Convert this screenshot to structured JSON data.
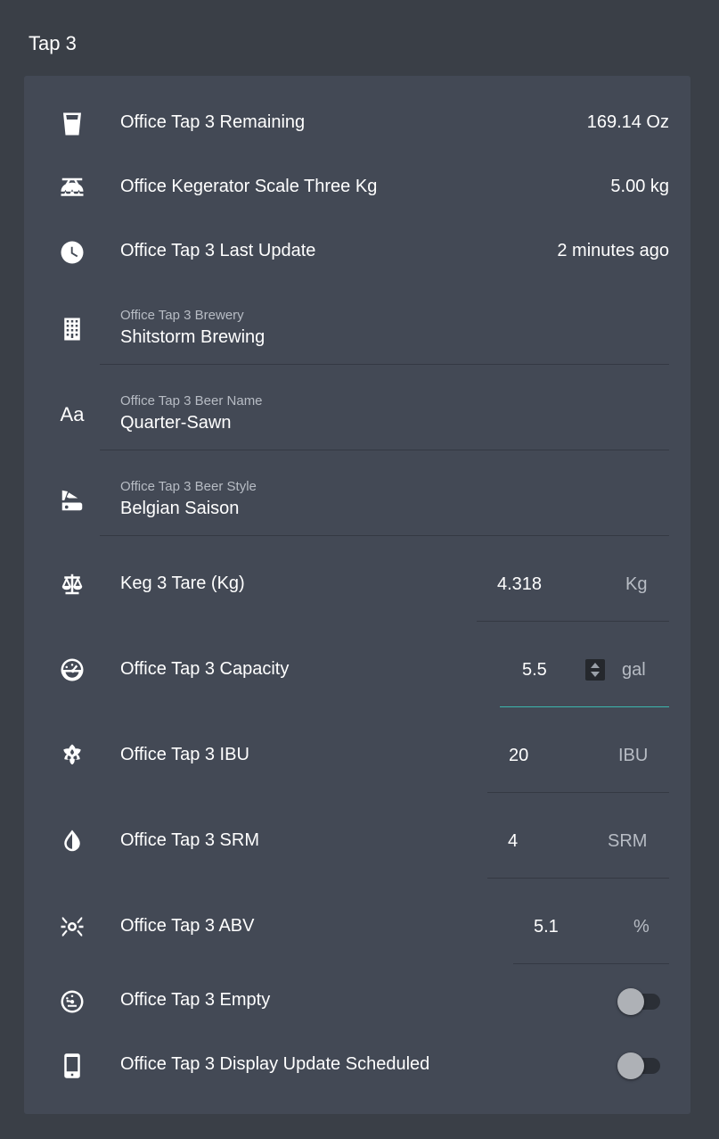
{
  "card_title": "Tap 3",
  "rows": {
    "remaining": {
      "label": "Office Tap 3 Remaining",
      "value": "169.14 Oz",
      "icon": "cup-icon"
    },
    "scale": {
      "label": "Office Kegerator Scale Three Kg",
      "value": "5.00 kg",
      "icon": "scale-icon"
    },
    "last_update": {
      "label": "Office Tap 3 Last Update",
      "value": "2 minutes ago",
      "icon": "clock-icon"
    },
    "brewery": {
      "label": "Office Tap 3 Brewery",
      "value": "Shitstorm Brewing",
      "icon": "building-icon"
    },
    "beer_name": {
      "label": "Office Tap 3 Beer Name",
      "value": "Quarter-Sawn",
      "icon": "text-format-icon",
      "icon_glyph": "Aa"
    },
    "beer_style": {
      "label": "Office Tap 3 Beer Style",
      "value": "Belgian Saison",
      "icon": "style-icon"
    },
    "tare": {
      "label": "Keg 3 Tare (Kg)",
      "value": "4.318",
      "unit": "Kg",
      "icon": "balance-scale-icon"
    },
    "capacity": {
      "label": "Office Tap 3 Capacity",
      "value": "5.5",
      "unit": "gal",
      "icon": "gauge-icon"
    },
    "ibu": {
      "label": "Office Tap 3 IBU",
      "value": "20",
      "unit": "IBU",
      "icon": "hops-icon"
    },
    "srm": {
      "label": "Office Tap 3 SRM",
      "value": "4",
      "unit": "SRM",
      "icon": "contrast-drop-icon"
    },
    "abv": {
      "label": "Office Tap 3 ABV",
      "value": "5.1",
      "unit": "%",
      "icon": "molecule-icon"
    },
    "empty": {
      "label": "Office Tap 3 Empty",
      "state": "off",
      "icon": "gauge-empty-icon"
    },
    "display_update": {
      "label": "Office Tap 3 Display Update Scheduled",
      "state": "off",
      "icon": "cellphone-icon"
    }
  },
  "colors": {
    "background": "#3a3f47",
    "card": "#434955",
    "accent": "#3bb6ae",
    "muted_text": "#b7bcc4"
  }
}
